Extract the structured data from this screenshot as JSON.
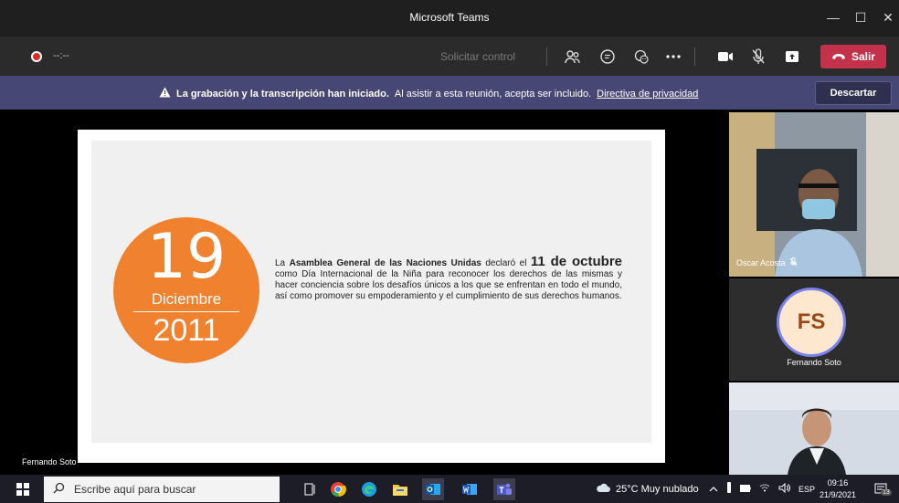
{
  "window": {
    "title": "Microsoft Teams"
  },
  "toolbar": {
    "timer": "--:--",
    "request_control_label": "Solicitar control",
    "leave_label": "Salir"
  },
  "banner": {
    "bold_text": "La grabación y la transcripción han iniciado.",
    "text": "Al asistir a esta reunión, acepta ser incluido.",
    "link_text": "Directiva de privacidad",
    "dismiss_label": "Descartar"
  },
  "slide": {
    "day": "19",
    "month": "Diciembre",
    "year": "2011",
    "text_pre": "La",
    "text_highlight": "Asamblea General de las Naciones Unidas",
    "text_mid": "declaró el",
    "text_date": "11 de octubre",
    "text_rest": "como Día Internacional de la Niña para reconocer los derechos de las mismas y hacer conciencia sobre los desafíos únicos a los que se enfrentan en todo el mundo, así como promover su empoderamiento y el cumplimiento de sus derechos humanos."
  },
  "presenter_name": "Fernando Soto",
  "participants": [
    {
      "name": "Oscar Acosta",
      "muted": true
    },
    {
      "initials": "FS",
      "name": "Fernando Soto",
      "avatar_bg": "#fde7cf",
      "avatar_ring": "#7b83eb"
    }
  ],
  "taskbar": {
    "search_placeholder": "Escribe aquí para buscar",
    "weather": "25°C  Muy nublado",
    "language": "ESP",
    "time": "09:16",
    "date": "21/9/2021",
    "notifications": "13"
  },
  "colors": {
    "leave": "#c4314b",
    "banner": "#464775",
    "badge": "#f0812e",
    "accent": "#7b83eb"
  }
}
